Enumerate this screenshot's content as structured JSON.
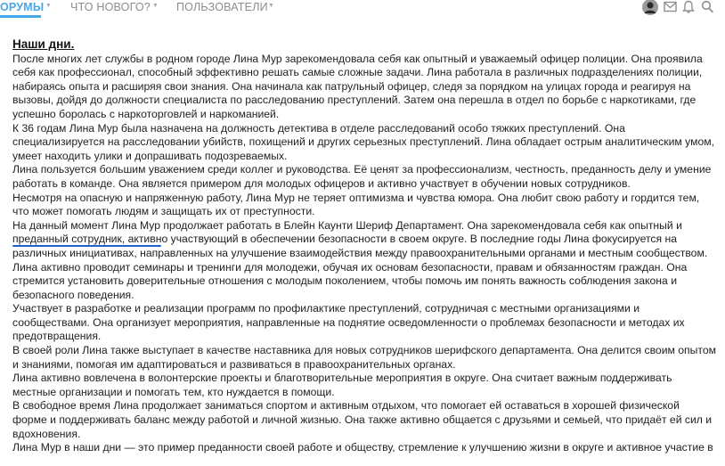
{
  "nav": {
    "tabs": [
      {
        "label": "ОРУМЫ",
        "active": true
      },
      {
        "label": "ЧТО НОВОГО?",
        "active": false
      },
      {
        "label": "ПОЛЬЗОВАТЕЛИ",
        "active": false
      }
    ],
    "accent": "#47a7eb",
    "icons": [
      "avatar",
      "mail-icon",
      "bell-icon",
      "search-icon"
    ]
  },
  "post": {
    "title": "Наши дни.",
    "paragraphs": [
      "После многих лет службы в родном городе Лина Мур зарекомендовала себя как опытный и уважаемый офицер полиции. Она проявила себя как профессионал, способный эффективно решать самые сложные задачи. Лина работала в различных подразделениях полиции, набираясь опыта и расширяя свои знания. Она начинала как патрульный офицер, следя за порядком на улицах города и реагируя на вызовы, дойдя до должности специалиста по расследованию преступлений. Затем она перешла в отдел по борьбе с наркотиками, где успешно боролась с наркоторговлей и наркоманией.",
      "К 36 годам Лина Мур была назначена на должность детектива в отделе расследований особо тяжких преступлений. Она специализируется на расследовании убийств, похищений и других серьезных преступлений. Лина обладает острым аналитическим умом, умеет находить улики и допрашивать подозреваемых.",
      "Лина пользуется большим уважением среди коллег и руководства. Её ценят за профессионализм, честность, преданность делу и умение работать в команде. Она является примером для молодых офицеров и активно участвует в обучении новых сотрудников.",
      "Несмотря на опасную и напряженную работу, Лина Мур не теряет оптимизма и чувства юмора. Она любит свою работу и гордится тем, что может помогать людям и защищать их от преступности.",
      "На данный момент Лина Мур продолжает работать в Блейн Каунти Шериф Департамент. Она зарекомендовала себя как опытный и преданный сотрудник, активно участвующий в обеспечении безопасности в своем округе. В последние годы Лина фокусируется на различных инициативах, направленных на улучшение взаимодействия между правоохранительными органами и местным сообществом.",
      "Лина активно проводит семинары и тренинги для молодежи, обучая их основам безопасности, правам и обязанностям граждан. Она стремится установить доверительные отношения с молодым поколением, чтобы помочь им понять важность соблюдения закона и безопасного поведения.",
      "Участвует в разработке и реализации программ по профилактике преступлений, сотрудничая с местными организациями и сообществами. Она организует мероприятия, направленные на поднятие осведомленности о проблемах безопасности и методах их предотвращения.",
      "В своей роли Лина также выступает в качестве наставника для новых сотрудников шерифского департамента. Она делится своим опытом и знаниями, помогая им адаптироваться и развиваться в правоохранительных органах.",
      "Лина активно вовлечена в волонтерские проекты и благотворительные мероприятия в округе. Она считает важным поддерживать местные организации и помогать тем, кто нуждается в помощи.",
      "В свободное время Лина продолжает заниматься спортом и активным отдыхом, что помогает ей оставаться в хорошей физической форме и поддерживать баланс между работой и личной жизнью. Она также активно общается с друзьями и семьей, что придаёт ей сил и вдохновения.",
      "Лина Мур в наши дни — это пример преданности своей работе и обществу, стремление к улучшению жизни в округе и активное участие в"
    ]
  },
  "annotation": {
    "color": "#1f62c8"
  }
}
